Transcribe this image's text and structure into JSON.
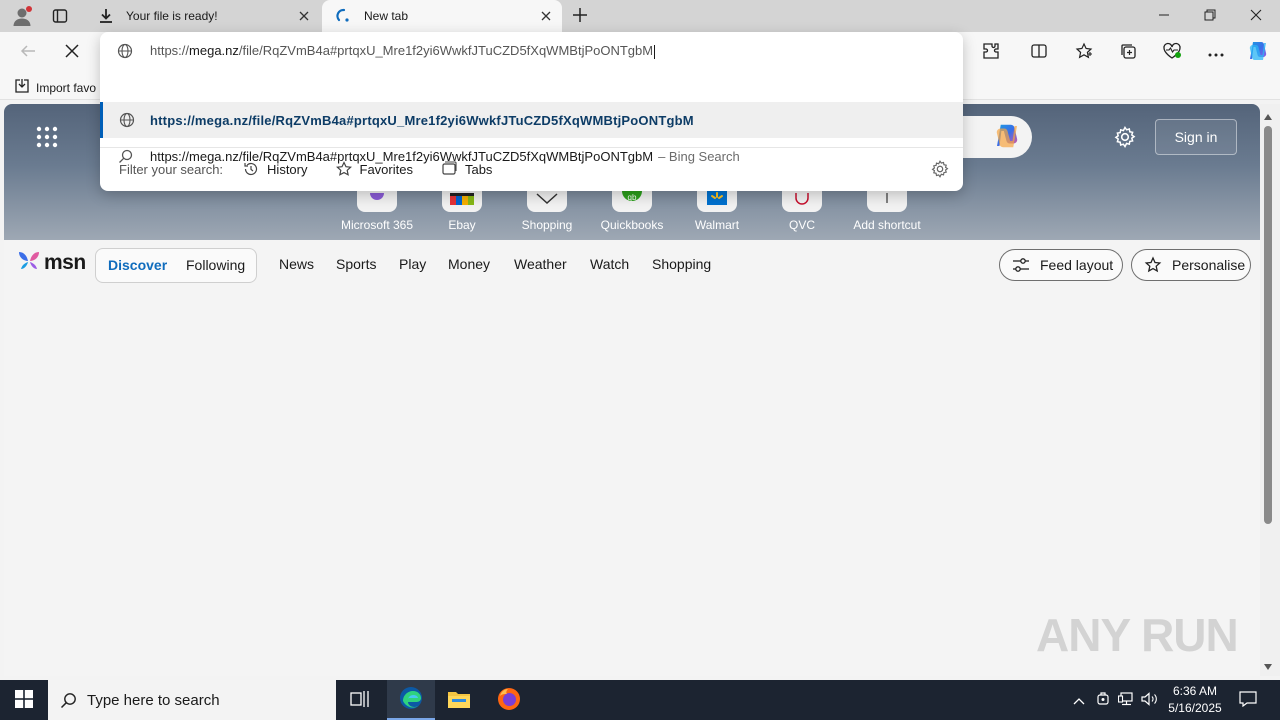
{
  "browser": {
    "tabs": [
      {
        "title": "Your file is ready!",
        "icon": "download-icon"
      },
      {
        "title": "New tab",
        "icon": "edge-loading-icon"
      }
    ],
    "new_tab_icon": "plus-icon",
    "favorites_bar": {
      "import_label": "Import favo"
    }
  },
  "omnibox": {
    "input_scheme": "https://",
    "input_host": "mega.nz",
    "input_path": "/file/RqZVmB4a#prtqxU_Mre1f2yi6WwkfJTuCZD5fXqWMBtjPoONTgbM",
    "suggestion_url": "https://mega.nz/file/RqZVmB4a#prtqxU_Mre1f2yi6WwkfJTuCZD5fXqWMBtjPoONTgbM",
    "search_text": "https://mega.nz/file/RqZVmB4a#prtqxU_Mre1f2yi6WwkfJTuCZD5fXqWMBtjPoONTgbM",
    "search_suffix": "– Bing Search",
    "filter_label": "Filter your search:",
    "filters": [
      "History",
      "Favorites",
      "Tabs"
    ]
  },
  "newtab": {
    "signin": "Sign in",
    "shortcuts": [
      "Microsoft 365",
      "Ebay",
      "Shopping",
      "Quickbooks",
      "Walmart",
      "QVC",
      "Add shortcut"
    ]
  },
  "msn": {
    "logo": "msn",
    "segments": [
      "Discover",
      "Following"
    ],
    "nav": [
      "News",
      "Sports",
      "Play",
      "Money",
      "Weather",
      "Watch",
      "Shopping"
    ],
    "feed_layout": "Feed layout",
    "personalise": "Personalise"
  },
  "watermark": "ANY RUN",
  "taskbar": {
    "search_placeholder": "Type here to search",
    "time": "6:36 AM",
    "date": "5/16/2025"
  },
  "colors": {
    "accent": "#0f6cbd",
    "taskbar": "#1c2431"
  }
}
